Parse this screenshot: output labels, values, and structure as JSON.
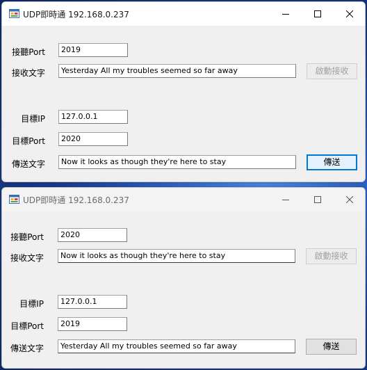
{
  "windows": [
    {
      "title": "UDP即時通 192.168.0.237",
      "listen_port_label": "接聽Port",
      "listen_port_value": "2019",
      "receive_text_label": "接收文字",
      "receive_text_value": "Yesterday All my troubles seemed so far away",
      "start_receive_label": "啟動接收",
      "target_ip_label": "目標IP",
      "target_ip_value": "127.0.0.1",
      "target_port_label": "目標Port",
      "target_port_value": "2020",
      "send_text_label": "傳送文字",
      "send_text_value": "Now it looks as though they're here to stay",
      "send_button_label": "傳送"
    },
    {
      "title": "UDP即時通 192.168.0.237",
      "listen_port_label": "接聽Port",
      "listen_port_value": "2020",
      "receive_text_label": "接收文字",
      "receive_text_value": "Now it looks as though they're here to stay",
      "start_receive_label": "啟動接收",
      "target_ip_label": "目標IP",
      "target_ip_value": "127.0.0.1",
      "target_port_label": "目標Port",
      "target_port_value": "2019",
      "send_text_label": "傳送文字",
      "send_text_value": "Yesterday All my troubles seemed so far away",
      "send_button_label": "傳送"
    }
  ],
  "icons": {
    "app": "app-window-icon",
    "minimize": "minimize-icon",
    "maximize": "maximize-icon",
    "close": "close-icon"
  },
  "colors": {
    "window_bg": "#f0f0f0",
    "accent": "#0078d7",
    "disabled_text": "#a0a0a0"
  }
}
